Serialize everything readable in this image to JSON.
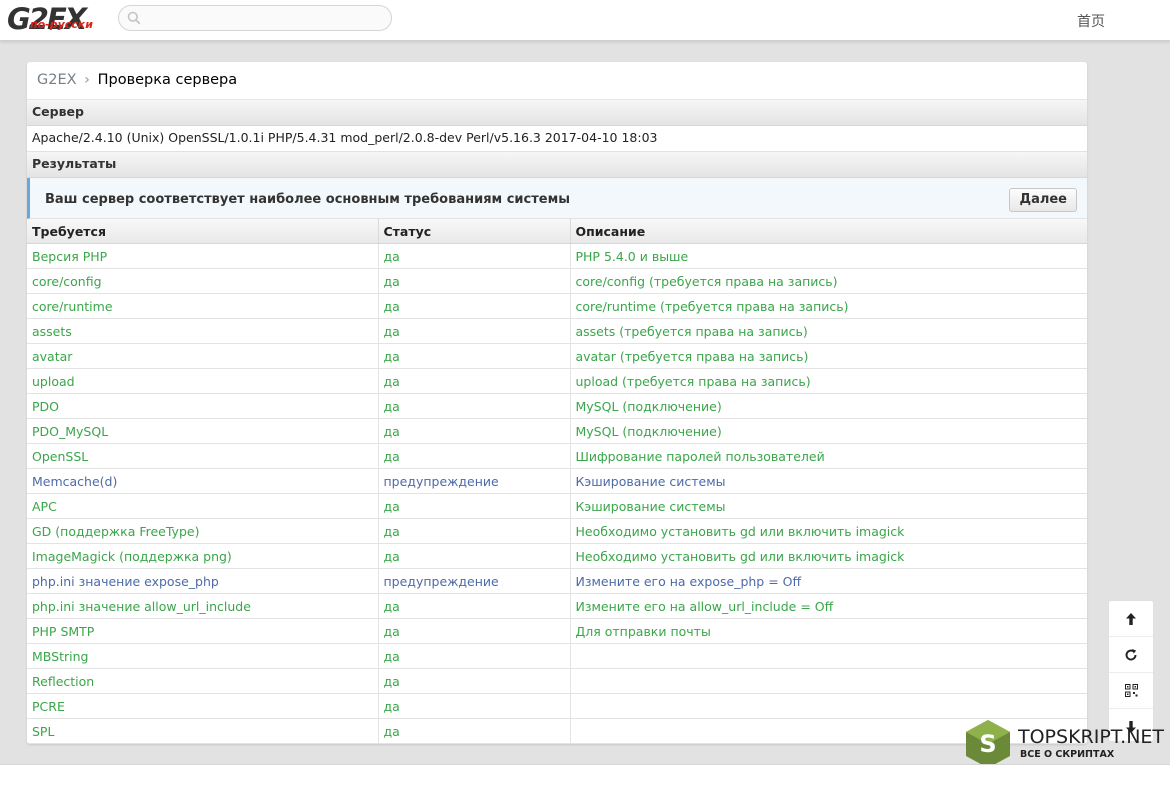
{
  "header": {
    "logo_main": "G2EX",
    "logo_sub": "по-русски",
    "search_placeholder": "",
    "nav_home": "首页"
  },
  "breadcrumb": {
    "root": "G2EX",
    "sep": "›",
    "current": "Проверка сервера"
  },
  "server": {
    "heading": "Сервер",
    "info": "Apache/2.4.10 (Unix) OpenSSL/1.0.1i PHP/5.4.31 mod_perl/2.0.8-dev Perl/v5.16.3 2017-04-10 18:03"
  },
  "results": {
    "heading": "Результаты",
    "notice": "Ваш сервер соответствует наиболее основным требованиям системы",
    "next_label": "Далее"
  },
  "table": {
    "columns": [
      "Требуется",
      "Статус",
      "Описание"
    ],
    "rows": [
      {
        "req": "Версия PHP",
        "status": "да",
        "desc": "PHP 5.4.0 и выше",
        "state": "ok"
      },
      {
        "req": "core/config",
        "status": "да",
        "desc": "core/config (требуется права на запись)",
        "state": "ok"
      },
      {
        "req": "core/runtime",
        "status": "да",
        "desc": "core/runtime (требуется права на запись)",
        "state": "ok"
      },
      {
        "req": "assets",
        "status": "да",
        "desc": "assets (требуется права на запись)",
        "state": "ok"
      },
      {
        "req": "avatar",
        "status": "да",
        "desc": "avatar (требуется права на запись)",
        "state": "ok"
      },
      {
        "req": "upload",
        "status": "да",
        "desc": "upload (требуется права на запись)",
        "state": "ok"
      },
      {
        "req": "PDO",
        "status": "да",
        "desc": "MySQL (подключение)",
        "state": "ok"
      },
      {
        "req": "PDO_MySQL",
        "status": "да",
        "desc": "MySQL (подключение)",
        "state": "ok"
      },
      {
        "req": "OpenSSL",
        "status": "да",
        "desc": "Шифрование паролей пользователей",
        "state": "ok"
      },
      {
        "req": "Memcache(d)",
        "status": "предупреждение",
        "desc": "Кэширование системы",
        "state": "warn"
      },
      {
        "req": "APC",
        "status": "да",
        "desc": "Кэширование системы",
        "state": "ok"
      },
      {
        "req": "GD (поддержка FreeType)",
        "status": "да",
        "desc": "Необходимо установить gd или включить imagick",
        "state": "ok"
      },
      {
        "req": "ImageMagick (поддержка png)",
        "status": "да",
        "desc": "Необходимо установить gd или включить imagick",
        "state": "ok"
      },
      {
        "req": "php.ini значение expose_php",
        "status": "предупреждение",
        "desc": "Измените его на expose_php = Off",
        "state": "warn"
      },
      {
        "req": "php.ini значение allow_url_include",
        "status": "да",
        "desc": "Измените его на allow_url_include = Off",
        "state": "ok"
      },
      {
        "req": "PHP SMTP",
        "status": "да",
        "desc": "Для отправки почты",
        "state": "ok"
      },
      {
        "req": "MBString",
        "status": "да",
        "desc": "",
        "state": "ok"
      },
      {
        "req": "Reflection",
        "status": "да",
        "desc": "",
        "state": "ok"
      },
      {
        "req": "PCRE",
        "status": "да",
        "desc": "",
        "state": "ok"
      },
      {
        "req": "SPL",
        "status": "да",
        "desc": "",
        "state": "ok"
      }
    ]
  },
  "tools": [
    "arrow-up-icon",
    "refresh-icon",
    "qr-code-icon",
    "arrow-down-icon"
  ],
  "watermark": {
    "badge": "S",
    "text": "TOPSKRIPT.NET",
    "sub": "ВСЕ О СКРИПТАХ"
  },
  "colors": {
    "ok": "#3aa64a",
    "warn": "#4d6aa8",
    "accent": "#6aa6d8"
  }
}
